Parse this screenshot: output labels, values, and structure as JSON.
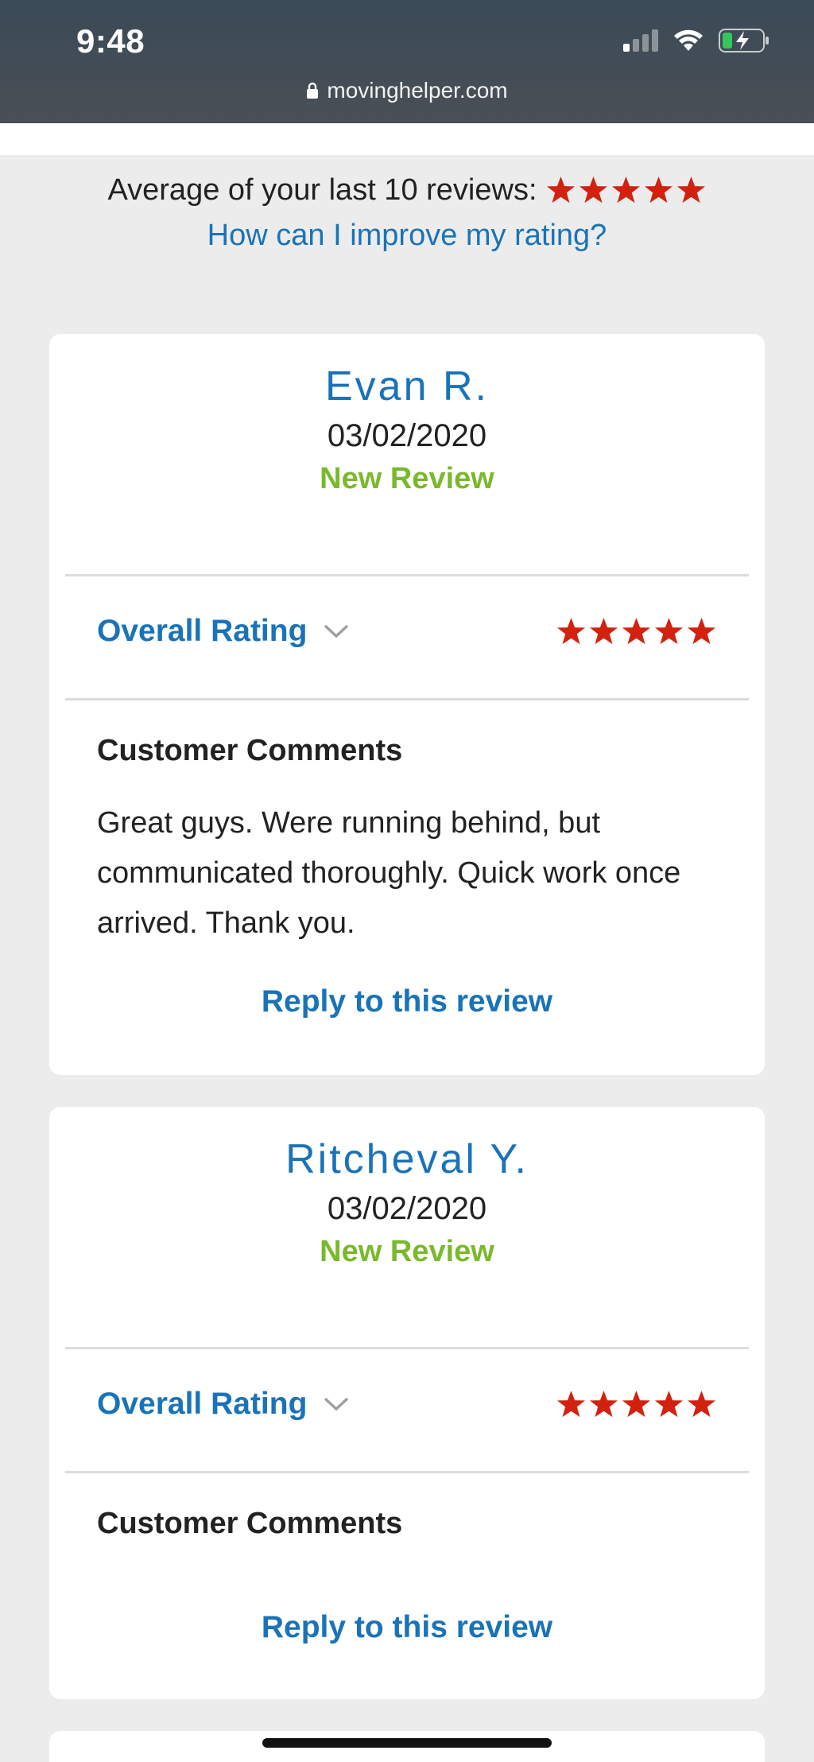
{
  "status_bar": {
    "time": "9:48"
  },
  "browser": {
    "url": "movinghelper.com"
  },
  "summary": {
    "average_text": "Average of your last 10 reviews:",
    "average_stars": 5,
    "improve_link": "How can I improve my rating?"
  },
  "colors": {
    "link_blue": "#1a73b8",
    "new_green": "#79b92c",
    "star_red": "#d2220f"
  },
  "reviews": [
    {
      "name": "Evan R.",
      "date": "03/02/2020",
      "status": "New Review",
      "rating_label": "Overall Rating",
      "stars": 5,
      "comments_title": "Customer Comments",
      "comment": "Great guys. Were running behind, but communicated thoroughly. Quick work once arrived. Thank you.",
      "reply_label": "Reply to this review"
    },
    {
      "name": "Ritcheval Y.",
      "date": "03/02/2020",
      "status": "New Review",
      "rating_label": "Overall Rating",
      "stars": 5,
      "comments_title": "Customer Comments",
      "comment": "",
      "reply_label": "Reply to this review"
    }
  ]
}
